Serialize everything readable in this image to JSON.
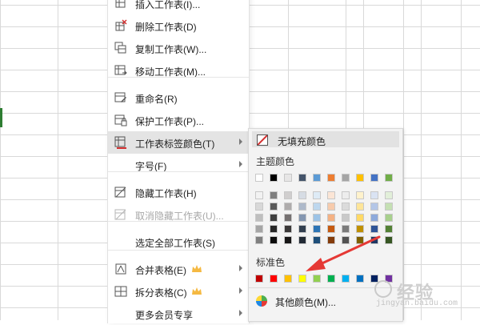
{
  "menu": {
    "items": [
      {
        "label": "插入工作表(I)...",
        "icon": "insert-sheet-icon",
        "has_submenu": false,
        "disabled": false,
        "highlight": false,
        "member": false
      },
      {
        "label": "删除工作表(D)",
        "icon": "delete-sheet-icon",
        "has_submenu": false,
        "disabled": false,
        "highlight": false,
        "member": false
      },
      {
        "label": "复制工作表(W)...",
        "icon": "copy-sheet-icon",
        "has_submenu": false,
        "disabled": false,
        "highlight": false,
        "member": false
      },
      {
        "label": "移动工作表(M)...",
        "icon": "move-sheet-icon",
        "has_submenu": false,
        "disabled": false,
        "highlight": false,
        "member": false
      },
      {
        "label": "重命名(R)",
        "icon": "rename-icon",
        "has_submenu": false,
        "disabled": false,
        "highlight": false,
        "member": false
      },
      {
        "label": "保护工作表(P)...",
        "icon": "protect-sheet-icon",
        "has_submenu": false,
        "disabled": false,
        "highlight": false,
        "member": false
      },
      {
        "label": "工作表标签颜色(T)",
        "icon": "tab-color-icon",
        "has_submenu": true,
        "disabled": false,
        "highlight": true,
        "member": false
      },
      {
        "label": "字号(F)",
        "icon": "",
        "has_submenu": true,
        "disabled": false,
        "highlight": false,
        "member": false
      },
      {
        "label": "隐藏工作表(H)",
        "icon": "hide-sheet-icon",
        "has_submenu": false,
        "disabled": false,
        "highlight": false,
        "member": false
      },
      {
        "label": "取消隐藏工作表(U)...",
        "icon": "unhide-sheet-icon",
        "has_submenu": false,
        "disabled": true,
        "highlight": false,
        "member": false
      },
      {
        "label": "选定全部工作表(S)",
        "icon": "",
        "has_submenu": false,
        "disabled": false,
        "highlight": false,
        "member": false
      },
      {
        "label": "合并表格(E)",
        "icon": "merge-table-icon",
        "has_submenu": true,
        "disabled": false,
        "highlight": false,
        "member": true
      },
      {
        "label": "拆分表格(C)",
        "icon": "split-table-icon",
        "has_submenu": true,
        "disabled": false,
        "highlight": false,
        "member": true
      },
      {
        "label": "更多会员专享",
        "icon": "",
        "has_submenu": true,
        "disabled": false,
        "highlight": false,
        "member": false
      }
    ]
  },
  "submenu": {
    "no_fill_label": "无填充颜色",
    "theme_heading": "主题颜色",
    "standard_heading": "标准色",
    "more_colors_label": "其他颜色(M)...",
    "theme_base": [
      "#ffffff",
      "#000000",
      "#e7e6e6",
      "#44546a",
      "#5b9bd5",
      "#ed7d31",
      "#a5a5a5",
      "#ffc000",
      "#4472c4",
      "#70ad47"
    ],
    "theme_shades": [
      [
        "#f2f2f2",
        "#7f7f7f",
        "#d0cece",
        "#d6dce4",
        "#deebf6",
        "#fbe5d5",
        "#ededed",
        "#fff2cc",
        "#dae3f3",
        "#e2efd9"
      ],
      [
        "#d8d8d8",
        "#595959",
        "#aeabab",
        "#adb9ca",
        "#bdd7ee",
        "#f7cbac",
        "#dbdbdb",
        "#fee599",
        "#b4c6e7",
        "#c5e0b3"
      ],
      [
        "#bfbfbf",
        "#3f3f3f",
        "#757070",
        "#8496b0",
        "#9dc3e6",
        "#f4b183",
        "#c9c9c9",
        "#ffd965",
        "#8eaadb",
        "#a8d08d"
      ],
      [
        "#a5a5a5",
        "#262626",
        "#3a3838",
        "#323f4f",
        "#2e75b5",
        "#c55a11",
        "#7b7b7b",
        "#bf9000",
        "#2f5496",
        "#538135"
      ],
      [
        "#7f7f7f",
        "#0c0c0c",
        "#171616",
        "#222a35",
        "#1e4e79",
        "#843c0b",
        "#525252",
        "#7f6000",
        "#1f3864",
        "#375623"
      ]
    ],
    "standard_colors": [
      "#c00000",
      "#ff0000",
      "#ffc000",
      "#ffff00",
      "#92d050",
      "#00b050",
      "#00b0f0",
      "#0070c0",
      "#002060",
      "#7030a0"
    ]
  },
  "colors": {
    "menu_highlight": "#e4e4e4",
    "annotation_arrow": "#e53935",
    "member_crown": "#f5b942",
    "active_cell": "#2e7d32"
  },
  "watermark": {
    "text": "经验",
    "url": "jingyan.baidu.com"
  }
}
